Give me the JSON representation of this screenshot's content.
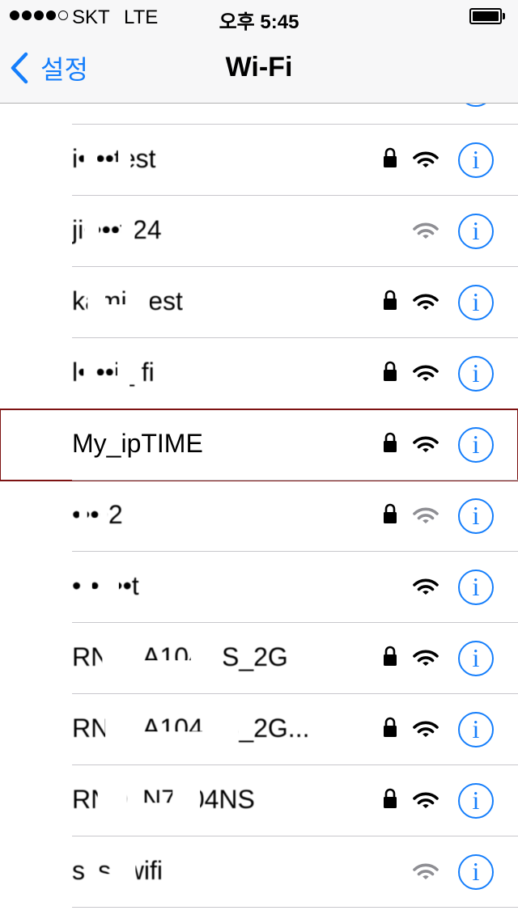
{
  "status_bar": {
    "signal_filled": 4,
    "signal_total": 5,
    "carrier": "SKT",
    "network_type": "LTE",
    "time": "오후 5:45",
    "battery_level": 1.0
  },
  "nav": {
    "back_label": "설정",
    "title": "Wi-Fi"
  },
  "networks": [
    {
      "name": "",
      "locked": false,
      "signal": "strong",
      "obscured": true
    },
    {
      "name": "i••••test",
      "locked": true,
      "signal": "strong",
      "obscured": true
    },
    {
      "name": "ji••••fi24",
      "locked": false,
      "signal": "weak",
      "obscured": true
    },
    {
      "name": "kami_test",
      "locked": true,
      "signal": "strong",
      "obscured": true
    },
    {
      "name": "l••••i_ fi",
      "locked": true,
      "signal": "strong",
      "obscured": true
    },
    {
      "name": "My_ipTIME",
      "locked": true,
      "signal": "strong",
      "obscured": false,
      "selected": true
    },
    {
      "name": "••••2",
      "locked": true,
      "signal": "weak",
      "obscured": true
    },
    {
      "name": "•••_••t",
      "locked": false,
      "signal": "strong",
      "obscured": true
    },
    {
      "name": "RND_A104NS_2G",
      "locked": true,
      "signal": "strong",
      "obscured": true
    },
    {
      "name": "RND_A104NS_2G...",
      "locked": true,
      "signal": "strong",
      "obscured": true
    },
    {
      "name": "RND_N7004NS",
      "locked": true,
      "signal": "strong",
      "obscured": true
    },
    {
      "name": "sss_wifi",
      "locked": false,
      "signal": "weak",
      "obscured": true
    }
  ],
  "colors": {
    "accent": "#157efb",
    "selection_outline": "#7d1212",
    "weak_signal": "#8e8e93",
    "strong_signal": "#000000"
  },
  "icons": {
    "lock": "lock-icon",
    "wifi": "wifi-icon",
    "info": "info-icon",
    "back": "chevron-left-icon"
  },
  "info_glyph": "i"
}
